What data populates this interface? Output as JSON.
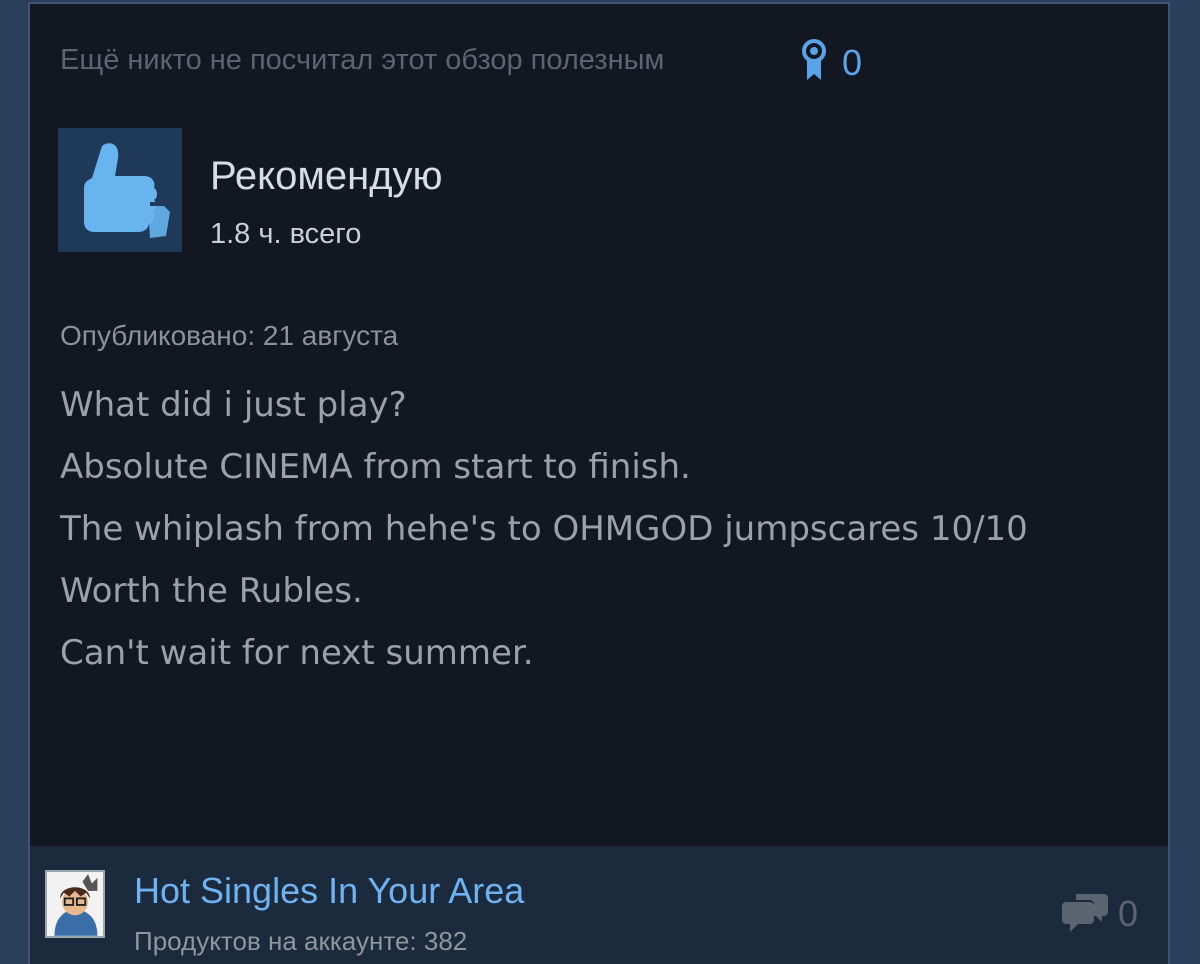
{
  "review": {
    "helpful_text": "Ещё никто не посчитал этот обзор полезным",
    "award_count": "0",
    "verdict": "Рекомендую",
    "hours": "1.8 ч. всего",
    "posted": "Опубликовано: 21 августа",
    "body_lines": [
      "What did i just play?",
      "Absolute CINEMA from start to finish.",
      "The whiplash from hehe's to OHMGOD jumpscares 10/10",
      "Worth the Rubles.",
      "Can't wait for next summer."
    ]
  },
  "author": {
    "name": "Hot Singles In Your Area",
    "products": "Продуктов на аккаунте: 382",
    "comment_count": "0"
  },
  "icons": {
    "award": "award-ribbon-icon",
    "thumb": "thumbs-up-icon",
    "comments": "comment-bubbles-icon"
  },
  "colors": {
    "accent_blue": "#5aa3e8",
    "card_bg": "#121722",
    "footer_bg": "#1c2a3d",
    "page_bg": "#2a3f5a"
  }
}
